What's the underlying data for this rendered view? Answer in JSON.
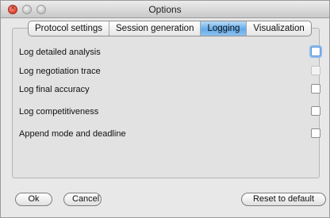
{
  "window": {
    "title": "Options"
  },
  "tabs": [
    {
      "label": "Protocol settings",
      "active": false
    },
    {
      "label": "Session generation",
      "active": false
    },
    {
      "label": "Logging",
      "active": true
    },
    {
      "label": "Visualization",
      "active": false
    }
  ],
  "logging": {
    "options": [
      {
        "label": "Log detailed analysis",
        "checked": false,
        "focused": true,
        "enabled": true
      },
      {
        "label": "Log negotiation trace",
        "checked": false,
        "focused": false,
        "enabled": false
      },
      {
        "label": "Log final accuracy",
        "checked": false,
        "focused": false,
        "enabled": true
      },
      {
        "label": "Log competitiveness",
        "checked": false,
        "focused": false,
        "enabled": true
      },
      {
        "label": "Append mode and deadline",
        "checked": false,
        "focused": false,
        "enabled": true
      }
    ]
  },
  "buttons": {
    "ok": "Ok",
    "cancel": "Cancel",
    "reset": "Reset to default"
  }
}
